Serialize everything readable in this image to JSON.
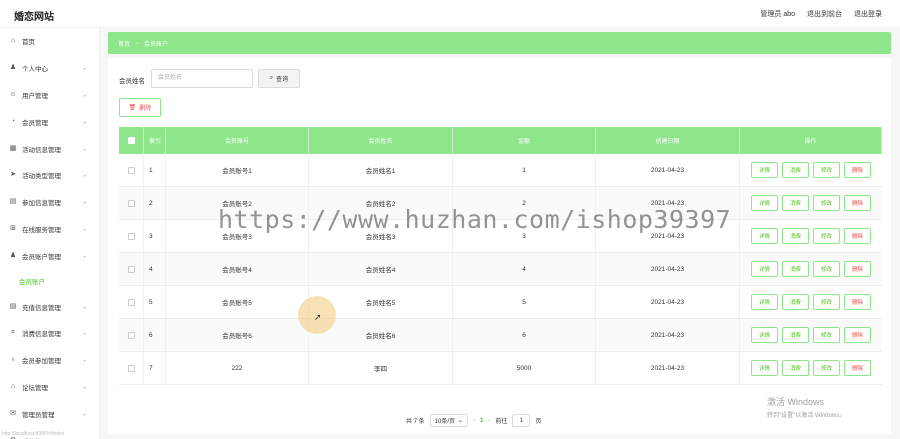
{
  "app": {
    "title": "婚恋网站"
  },
  "header": {
    "admin_label": "管理员 abo",
    "back_front": "退出到前台",
    "logout": "退出登录"
  },
  "sidebar": {
    "items": [
      {
        "label": "首页",
        "icon": "home-icon",
        "glyph": "⌂"
      },
      {
        "label": "个人中心",
        "icon": "user-icon",
        "glyph": "♟"
      },
      {
        "label": "用户管理",
        "icon": "user-manage-icon",
        "glyph": "☺"
      },
      {
        "label": "会员管理",
        "icon": "member-icon",
        "glyph": "◔"
      },
      {
        "label": "活动信息管理",
        "icon": "activity-icon",
        "glyph": "▦"
      },
      {
        "label": "活动类型管理",
        "icon": "send-icon",
        "glyph": "➤"
      },
      {
        "label": "参加信息管理",
        "icon": "join-icon",
        "glyph": "▤"
      },
      {
        "label": "在线服务管理",
        "icon": "grid-icon",
        "glyph": "⊞"
      },
      {
        "label": "会员账户管理",
        "icon": "account-icon",
        "glyph": "♟"
      }
    ],
    "active_sub": "会员账户",
    "items_after": [
      {
        "label": "充值信息管理",
        "icon": "recharge-icon",
        "glyph": "▤"
      },
      {
        "label": "消费信息管理",
        "icon": "scan-icon",
        "glyph": "⌗"
      },
      {
        "label": "会员参加管理",
        "icon": "mic-icon",
        "glyph": "♁"
      },
      {
        "label": "论坛管理",
        "icon": "forum-icon",
        "glyph": "⌂"
      },
      {
        "label": "管理员管理",
        "icon": "mail-icon",
        "glyph": "✉"
      },
      {
        "label": "系统管理",
        "icon": "system-icon",
        "glyph": "⚙"
      }
    ]
  },
  "breadcrumb": {
    "home": "首页",
    "arrow": "→",
    "current": "会员账户"
  },
  "search": {
    "label": "会员姓名",
    "placeholder": "会员姓名",
    "button": "查询"
  },
  "actions": {
    "delete": "删除"
  },
  "table": {
    "headers": [
      "索引",
      "会员账号",
      "会员姓名",
      "金额",
      "创建日期",
      "操作"
    ],
    "rows": [
      {
        "idx": "1",
        "account": "会员账号1",
        "name": "会员姓名1",
        "balance": "1",
        "date": "2021-04-23"
      },
      {
        "idx": "2",
        "account": "会员账号2",
        "name": "会员姓名2",
        "balance": "2",
        "date": "2021-04-23"
      },
      {
        "idx": "3",
        "account": "会员账号3",
        "name": "会员姓名3",
        "balance": "3",
        "date": "2021-04-23"
      },
      {
        "idx": "4",
        "account": "会员账号4",
        "name": "会员姓名4",
        "balance": "4",
        "date": "2021-04-23"
      },
      {
        "idx": "5",
        "account": "会员账号5",
        "name": "会员姓名5",
        "balance": "5",
        "date": "2021-04-23"
      },
      {
        "idx": "6",
        "account": "会员账号6",
        "name": "会员姓名6",
        "balance": "6",
        "date": "2021-04-23"
      },
      {
        "idx": "7",
        "account": "222",
        "name": "李四",
        "balance": "5000",
        "date": "2021-04-23"
      }
    ],
    "op_labels": {
      "detail": "详情",
      "consume": "消费",
      "edit": "修改",
      "delete": "删除"
    }
  },
  "pagination": {
    "total": "共 7 条",
    "page_size": "10条/页",
    "prev": "‹",
    "current": "1",
    "next": "›",
    "goto": "前往",
    "goto_value": "1",
    "page_unit": "页"
  },
  "overlay": {
    "watermark": "https://www.huzhan.com/ishop39397",
    "activate_title": "激活 Windows",
    "activate_sub": "转到\"设置\"以激活 Windows。",
    "footer_note": "http://localhost:8080/#/index"
  },
  "colors": {
    "accent": "#8ee68a",
    "accent_text": "#52c41a",
    "danger": "#e84d4d"
  }
}
